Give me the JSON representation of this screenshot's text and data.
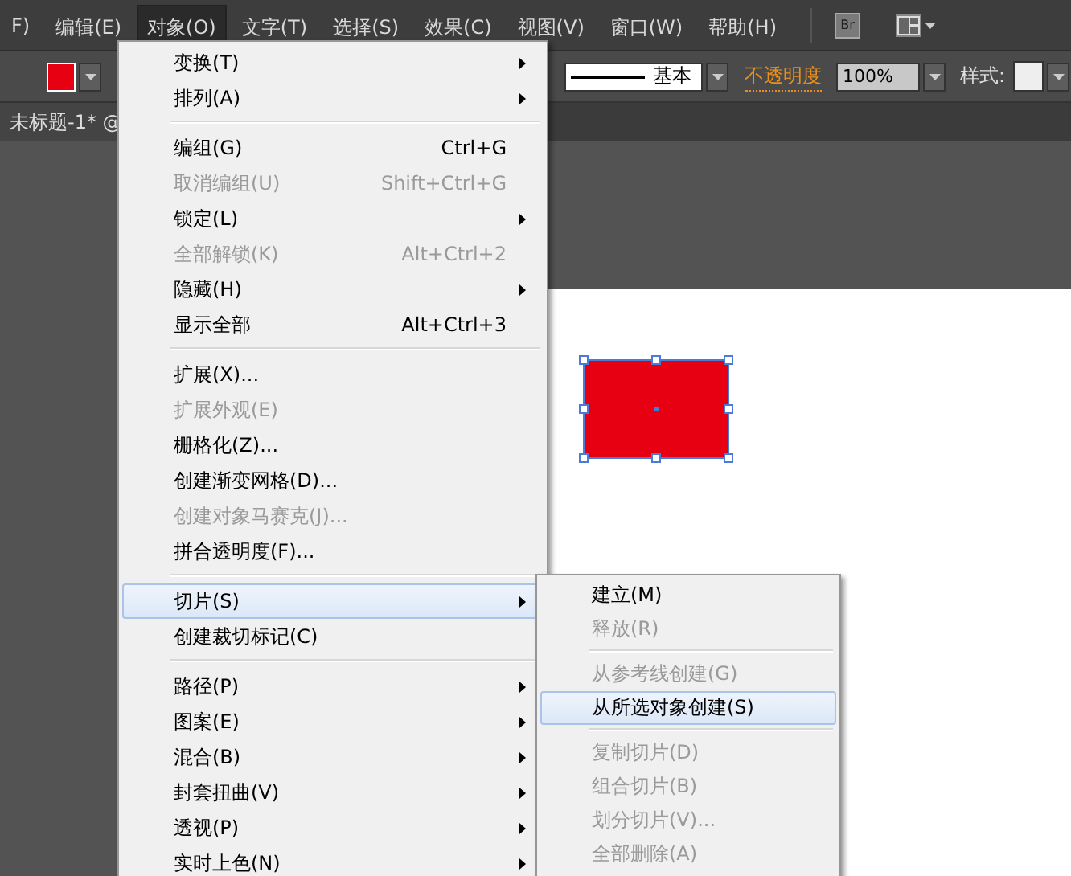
{
  "menu_bar": {
    "items": [
      {
        "label": "F)",
        "selected": false
      },
      {
        "label": "编辑(E)",
        "selected": false
      },
      {
        "label": "对象(O)",
        "selected": true
      },
      {
        "label": "文字(T)",
        "selected": false
      },
      {
        "label": "选择(S)",
        "selected": false
      },
      {
        "label": "效果(C)",
        "selected": false
      },
      {
        "label": "视图(V)",
        "selected": false
      },
      {
        "label": "窗口(W)",
        "selected": false
      },
      {
        "label": "帮助(H)",
        "selected": false
      }
    ],
    "bridge_button": "Br"
  },
  "toolbar": {
    "stroke_style": "基本",
    "opacity_label": "不透明度",
    "opacity_value": "100%",
    "style_label": "样式:"
  },
  "document_tab": {
    "title": "未标题-1* @"
  },
  "object_menu": {
    "groups": [
      {
        "items": [
          {
            "label": "变换(T)",
            "submenu": true,
            "disabled": false,
            "selected": false
          },
          {
            "label": "排列(A)",
            "submenu": true,
            "disabled": false,
            "selected": false
          }
        ]
      },
      {
        "items": [
          {
            "label": "编组(G)",
            "shortcut": "Ctrl+G",
            "submenu": false,
            "disabled": false,
            "selected": false
          },
          {
            "label": "取消编组(U)",
            "shortcut": "Shift+Ctrl+G",
            "submenu": false,
            "disabled": true,
            "selected": false
          },
          {
            "label": "锁定(L)",
            "submenu": true,
            "disabled": false,
            "selected": false
          },
          {
            "label": "全部解锁(K)",
            "shortcut": "Alt+Ctrl+2",
            "submenu": false,
            "disabled": true,
            "selected": false
          },
          {
            "label": "隐藏(H)",
            "submenu": true,
            "disabled": false,
            "selected": false
          },
          {
            "label": "显示全部",
            "shortcut": "Alt+Ctrl+3",
            "submenu": false,
            "disabled": false,
            "selected": false
          }
        ]
      },
      {
        "items": [
          {
            "label": "扩展(X)...",
            "submenu": false,
            "disabled": false,
            "selected": false
          },
          {
            "label": "扩展外观(E)",
            "submenu": false,
            "disabled": true,
            "selected": false
          },
          {
            "label": "栅格化(Z)...",
            "submenu": false,
            "disabled": false,
            "selected": false
          },
          {
            "label": "创建渐变网格(D)...",
            "submenu": false,
            "disabled": false,
            "selected": false
          },
          {
            "label": "创建对象马赛克(J)...",
            "submenu": false,
            "disabled": true,
            "selected": false
          },
          {
            "label": "拼合透明度(F)...",
            "submenu": false,
            "disabled": false,
            "selected": false
          }
        ]
      },
      {
        "items": [
          {
            "label": "切片(S)",
            "submenu": true,
            "disabled": false,
            "selected": true
          },
          {
            "label": "创建裁切标记(C)",
            "submenu": false,
            "disabled": false,
            "selected": false
          }
        ]
      },
      {
        "items": [
          {
            "label": "路径(P)",
            "submenu": true,
            "disabled": false,
            "selected": false
          },
          {
            "label": "图案(E)",
            "submenu": true,
            "disabled": false,
            "selected": false
          },
          {
            "label": "混合(B)",
            "submenu": true,
            "disabled": false,
            "selected": false
          },
          {
            "label": "封套扭曲(V)",
            "submenu": true,
            "disabled": false,
            "selected": false
          },
          {
            "label": "透视(P)",
            "submenu": true,
            "disabled": false,
            "selected": false
          },
          {
            "label": "实时上色(N)",
            "submenu": true,
            "disabled": false,
            "selected": false
          }
        ]
      }
    ]
  },
  "slice_submenu": {
    "groups": [
      {
        "items": [
          {
            "label": "建立(M)",
            "submenu": false,
            "disabled": false,
            "selected": false
          },
          {
            "label": "释放(R)",
            "submenu": false,
            "disabled": true,
            "selected": false
          }
        ]
      },
      {
        "items": [
          {
            "label": "从参考线创建(G)",
            "submenu": false,
            "disabled": true,
            "selected": false
          },
          {
            "label": "从所选对象创建(S)",
            "submenu": false,
            "disabled": false,
            "selected": true
          }
        ]
      },
      {
        "items": [
          {
            "label": "复制切片(D)",
            "submenu": false,
            "disabled": true,
            "selected": false
          },
          {
            "label": "组合切片(B)",
            "submenu": false,
            "disabled": true,
            "selected": false
          },
          {
            "label": "划分切片(V)...",
            "submenu": false,
            "disabled": true,
            "selected": false
          },
          {
            "label": "全部删除(A)",
            "submenu": false,
            "disabled": true,
            "selected": false
          }
        ]
      }
    ]
  }
}
